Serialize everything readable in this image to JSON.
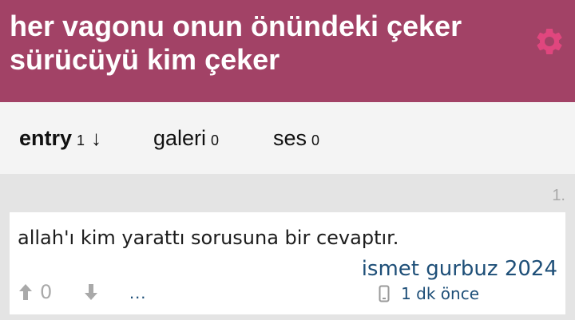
{
  "topic": {
    "title": "her vagonu onun önündeki çeker sürücüyü kim çeker"
  },
  "colors": {
    "header": "#a24266",
    "gear": "#e0467e",
    "link": "#1e4f78",
    "muted": "#a9a9a9"
  },
  "tabs": [
    {
      "label": "entry",
      "count": "1",
      "sort": "↓"
    },
    {
      "label": "galeri",
      "count": "0"
    },
    {
      "label": "ses",
      "count": "0"
    }
  ],
  "entry": {
    "number": "1.",
    "text": "allah'ı kim yarattı sorusuna bir cevaptır.",
    "author": "ismet gurbuz 2024",
    "time": "1 dk önce",
    "votes": "0",
    "more": "...",
    "device_icon": "phone-icon"
  }
}
